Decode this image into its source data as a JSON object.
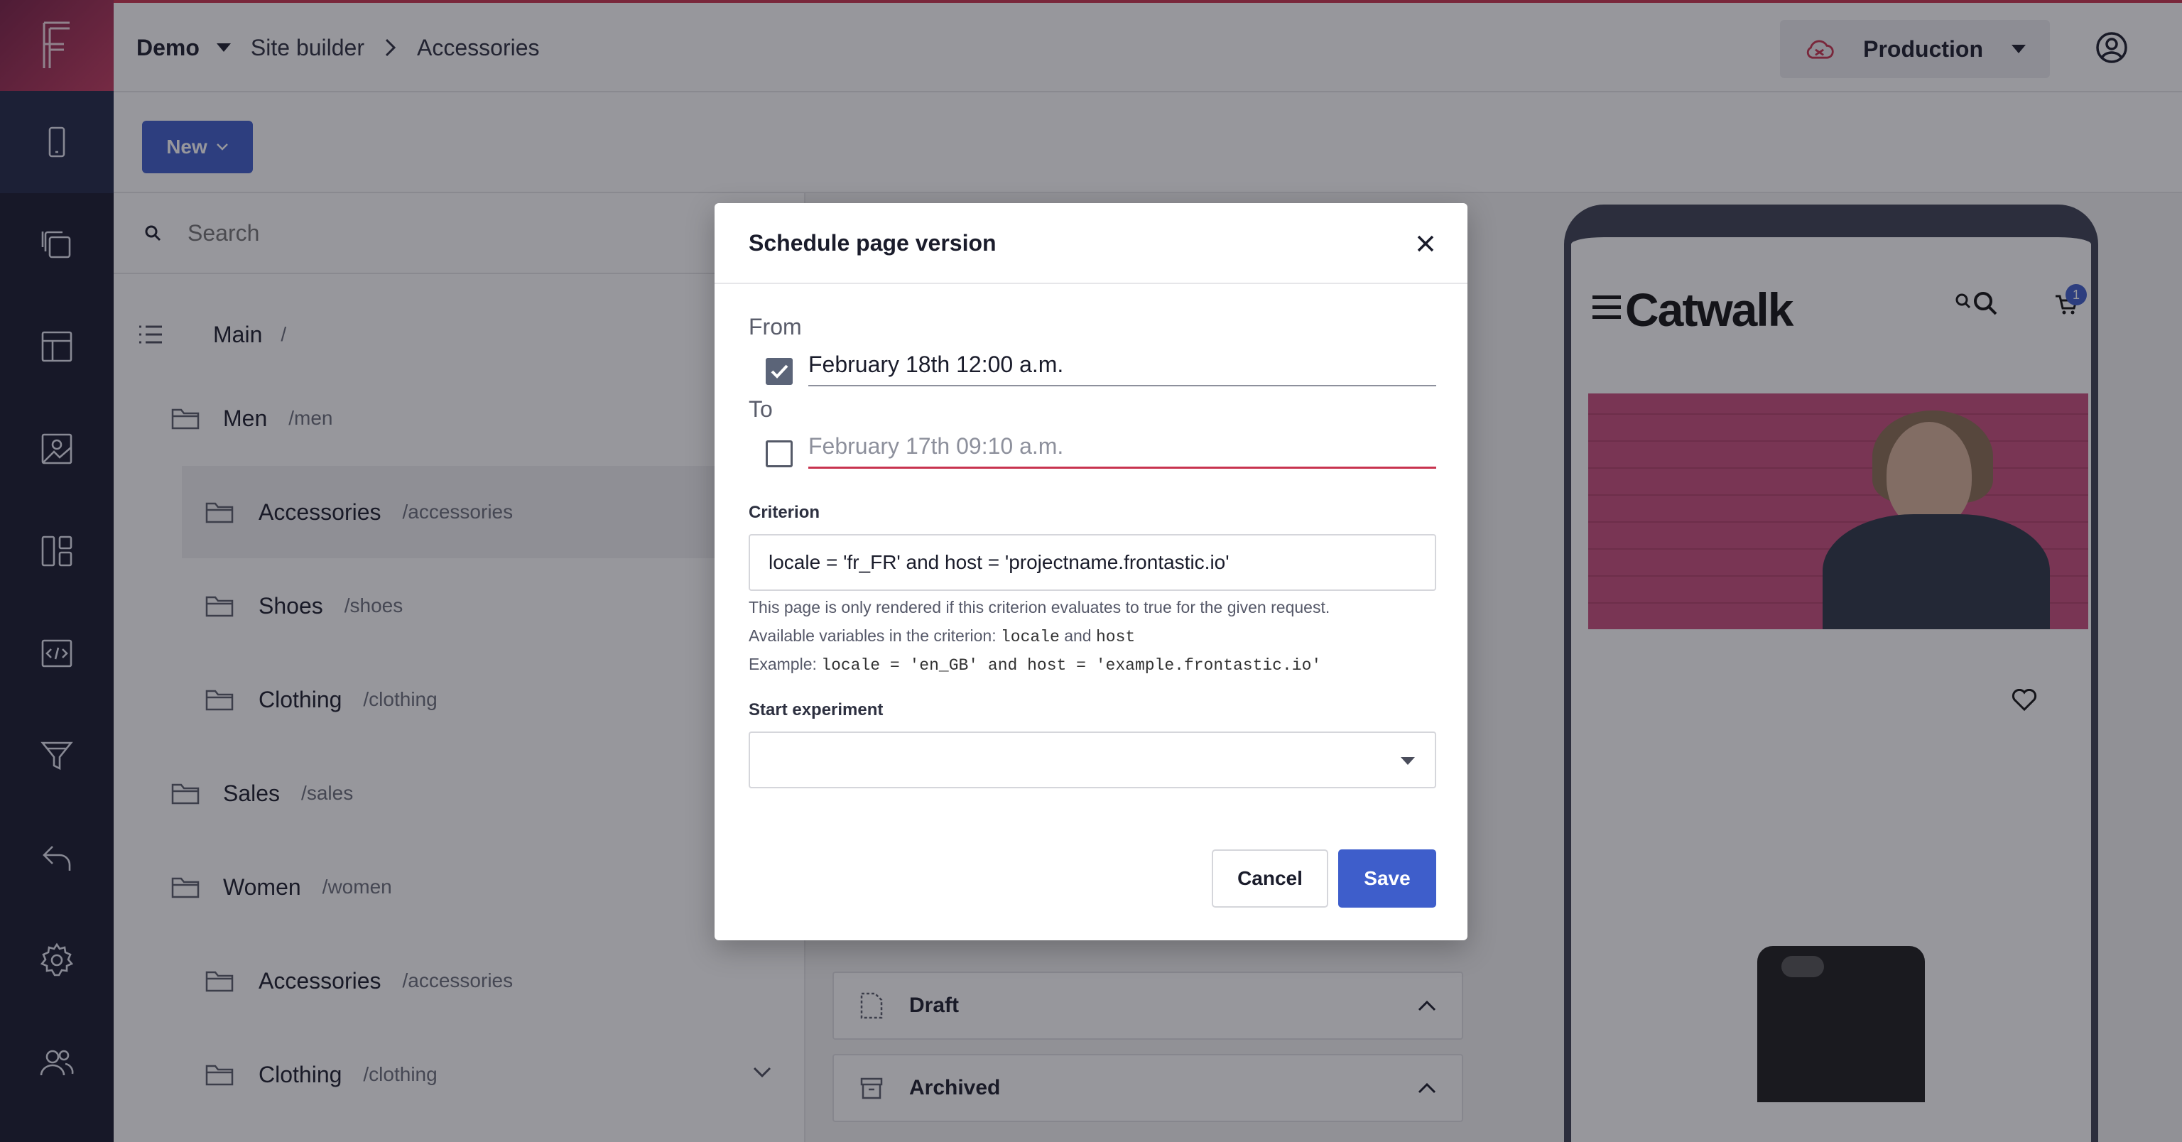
{
  "app": {
    "project_name": "Demo",
    "breadcrumbs": [
      "Site builder",
      "Accessories"
    ],
    "environment": "Production"
  },
  "sidebar": {
    "items": [
      {
        "icon": "mobile-device-icon"
      },
      {
        "icon": "copy-pages-icon"
      },
      {
        "icon": "layout-template-icon"
      },
      {
        "icon": "media-image-icon"
      },
      {
        "icon": "dashboard-panels-icon"
      },
      {
        "icon": "code-component-icon"
      },
      {
        "icon": "filter-funnel-icon"
      },
      {
        "icon": "undo-arrow-icon"
      },
      {
        "icon": "settings-gear-icon"
      },
      {
        "icon": "users-icon"
      }
    ]
  },
  "toolbar": {
    "new_label": "New"
  },
  "tree": {
    "search_placeholder": "Search",
    "root": {
      "name": "Main",
      "path": "/"
    },
    "nodes": [
      {
        "name": "Men",
        "path": "/men"
      },
      {
        "name": "Accessories",
        "path": "/accessories"
      },
      {
        "name": "Shoes",
        "path": "/shoes"
      },
      {
        "name": "Clothing",
        "path": "/clothing"
      },
      {
        "name": "Sales",
        "path": "/sales"
      },
      {
        "name": "Women",
        "path": "/women"
      },
      {
        "name": "Accessories",
        "path": "/accessories"
      },
      {
        "name": "Clothing",
        "path": "/clothing"
      }
    ]
  },
  "versions": {
    "draft_label": "Draft",
    "archived_label": "Archived"
  },
  "preview": {
    "brand": "Catwalk",
    "cart_count": "1"
  },
  "modal": {
    "title": "Schedule page version",
    "from_label": "From",
    "from_value": "February 18th 12:00 a.m.",
    "from_checked": true,
    "to_label": "To",
    "to_value": "February 17th 09:10 a.m.",
    "to_checked": false,
    "criterion_label": "Criterion",
    "criterion_value": "locale = 'fr_FR' and host = 'projectname.frontastic.io'",
    "help_line1": "This page is only rendered if this criterion evaluates to true for the given request.",
    "help_line2_prefix": "Available variables in the criterion:",
    "help_var_locale": "locale",
    "help_and": "and",
    "help_var_host": "host",
    "help_line3_prefix": "Example:",
    "help_example": "locale = 'en_GB' and host = 'example.frontastic.io'",
    "experiment_label": "Start experiment",
    "experiment_value": "",
    "cancel_label": "Cancel",
    "save_label": "Save"
  },
  "colors": {
    "accent": "#3e5ecb",
    "error": "#c8334f",
    "rail": "#16192d"
  }
}
